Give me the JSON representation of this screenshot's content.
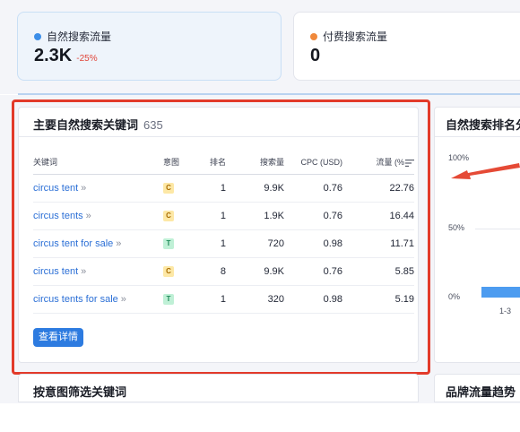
{
  "organic": {
    "label": "自然搜索流量",
    "value": "2.3K",
    "change": "-25%",
    "dot_color": "#3c8ee8"
  },
  "paid": {
    "label": "付费搜索流量",
    "value": "0",
    "dot_color": "#f0893b"
  },
  "keywords_panel": {
    "title": "主要自然搜索关键词",
    "count": "635",
    "columns": {
      "keyword": "关键词",
      "intent": "意图",
      "rank": "排名",
      "volume": "搜索量",
      "cpc": "CPC (USD)",
      "traffic": "流量 (%"
    },
    "rows": [
      {
        "keyword": "circus tent",
        "intent": "C",
        "rank": "1",
        "volume": "9.9K",
        "cpc": "0.76",
        "traffic": "22.76"
      },
      {
        "keyword": "circus tents",
        "intent": "C",
        "rank": "1",
        "volume": "1.9K",
        "cpc": "0.76",
        "traffic": "16.44"
      },
      {
        "keyword": "circus tent for sale",
        "intent": "T",
        "rank": "1",
        "volume": "720",
        "cpc": "0.98",
        "traffic": "11.71"
      },
      {
        "keyword": "circus tent",
        "intent": "C",
        "rank": "8",
        "volume": "9.9K",
        "cpc": "0.76",
        "traffic": "5.85"
      },
      {
        "keyword": "circus tents for sale",
        "intent": "T",
        "rank": "1",
        "volume": "320",
        "cpc": "0.98",
        "traffic": "5.19"
      }
    ],
    "button": "查看详情"
  },
  "rank_panel": {
    "title": "自然搜索排名分",
    "y_labels": [
      "100%",
      "50%",
      "0%"
    ],
    "x_label": "1-3",
    "bar_fraction": 0.04
  },
  "intent_filter_panel": {
    "title": "按意图筛选关键词"
  },
  "brand_panel": {
    "title": "品牌流量趋势"
  },
  "colors": {
    "accent": "#2d7be0",
    "highlight": "#e23a2a",
    "arrow": "#e54a36",
    "intent_c": "#fde8a6",
    "intent_t": "#bff0d6",
    "bar": "#4d9cf0"
  }
}
